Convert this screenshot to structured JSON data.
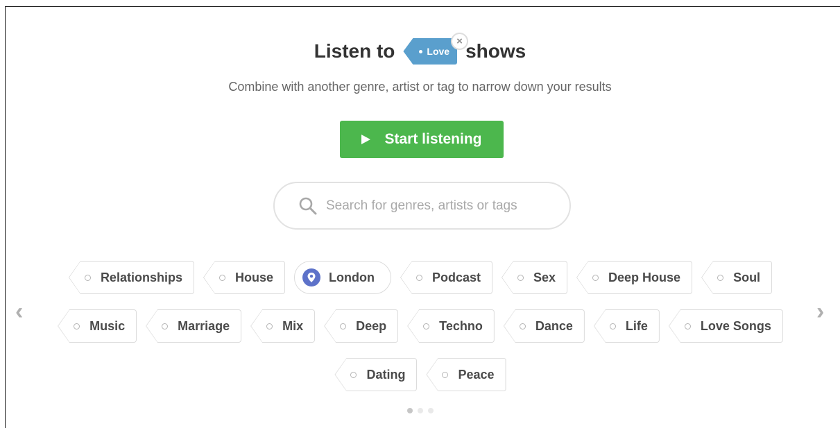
{
  "header": {
    "title_prefix": "Listen to",
    "active_tag": "Love",
    "remove_glyph": "×",
    "title_suffix": "shows",
    "subtitle": "Combine with another genre, artist or tag to narrow down your results"
  },
  "start_button": {
    "label": "Start listening",
    "icon": "play-icon"
  },
  "search": {
    "placeholder": "Search for genres, artists or tags",
    "icon": "search-icon",
    "value": ""
  },
  "tags": {
    "row1": [
      "Relationships",
      "House",
      "London",
      "Podcast",
      "Sex",
      "Deep House",
      "Soul"
    ],
    "row2": [
      "Music",
      "Marriage",
      "Mix",
      "Deep",
      "Techno",
      "Dance",
      "Life",
      "Love Songs"
    ],
    "row3": [
      "Dating",
      "Peace"
    ],
    "location_tag": "London"
  },
  "carousel": {
    "prev_glyph": "‹",
    "next_glyph": "›",
    "page_count": 3,
    "current_page": 1
  },
  "colors": {
    "accent_green": "#4cb74d",
    "tag_blue": "#5a9fcd",
    "location_pin": "#5d72c9",
    "text_dark": "#333333"
  }
}
